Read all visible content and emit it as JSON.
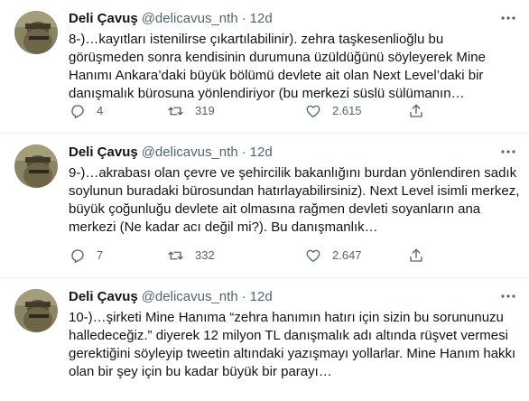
{
  "tweets": [
    {
      "author_name": "Deli Çavuş",
      "author_handle": "@delicavus_nth",
      "separator": "·",
      "time": "12d",
      "text": "8-)…kayıtları istenilirse çıkartılabilinir). zehra taşkesenlioğlu bu görüşmeden sonra kendisinin durumuna üzüldüğünü söyleyerek Mine Hanımı Ankara’daki büyük bölümü devlete ait olan Next Level’daki bir danışmalık bürosuna yönlendiriyor (bu merkezi süslü sülümanın…",
      "replies": "4",
      "retweets": "319",
      "likes": "2.615"
    },
    {
      "author_name": "Deli Çavuş",
      "author_handle": "@delicavus_nth",
      "separator": "·",
      "time": "12d",
      "text": "9-)…akrabası olan çevre ve şehircilik bakanlığını burdan yönlendiren sadık soylunun buradaki bürosundan hatırlayabilirsiniz). Next Level isimli merkez, büyük çoğunluğu devlete ait olmasına rağmen devleti soyanların ana merkezi (Ne kadar acı değil mi?). Bu danışmanlık…",
      "replies": "7",
      "retweets": "332",
      "likes": "2.647"
    },
    {
      "author_name": "Deli Çavuş",
      "author_handle": "@delicavus_nth",
      "separator": "·",
      "time": "12d",
      "text": "10-)…şirketi Mine Hanıma “zehra hanımın hatırı için sizin bu sorununuzu halledeceğiz.” diyerek 12 milyon TL danışmalık adı altında rüşvet vermesi gerektiğini söyleyip tweetin altındaki yazışmayı yollarlar. Mine Hanım hakkı olan bir şey için bu kadar büyük bir parayı…",
      "replies": "",
      "retweets": "",
      "likes": ""
    }
  ],
  "icons": {
    "reply": "reply-icon",
    "retweet": "retweet-icon",
    "like": "heart-icon",
    "share": "share-icon",
    "more": "more-icon"
  },
  "colors": {
    "name": "#0f1419",
    "secondary": "#536471",
    "divider": "#eff3f4"
  }
}
